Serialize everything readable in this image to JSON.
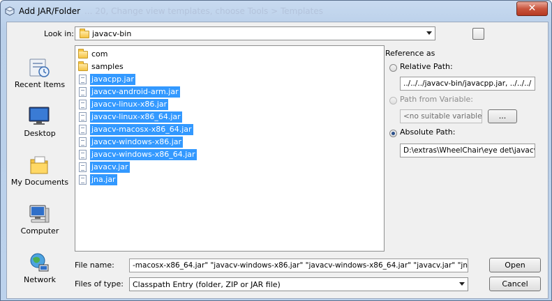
{
  "window": {
    "title": "Add JAR/Folder",
    "title_ghost": "... 20, Change view templates, choose Tools > Templates",
    "close_label": "✕"
  },
  "lookin": {
    "label": "Look in:",
    "value": "javacv-bin"
  },
  "places": [
    {
      "label": "Recent Items",
      "icon": "recent-items-icon"
    },
    {
      "label": "Desktop",
      "icon": "desktop-icon"
    },
    {
      "label": "My Documents",
      "icon": "my-documents-icon"
    },
    {
      "label": "Computer",
      "icon": "computer-icon"
    },
    {
      "label": "Network",
      "icon": "network-icon"
    }
  ],
  "files": [
    {
      "name": "com",
      "type": "folder",
      "selected": false
    },
    {
      "name": "samples",
      "type": "folder",
      "selected": false
    },
    {
      "name": "javacpp.jar",
      "type": "jar",
      "selected": true
    },
    {
      "name": "javacv-android-arm.jar",
      "type": "jar",
      "selected": true
    },
    {
      "name": "javacv-linux-x86.jar",
      "type": "jar",
      "selected": true
    },
    {
      "name": "javacv-linux-x86_64.jar",
      "type": "jar",
      "selected": true
    },
    {
      "name": "javacv-macosx-x86_64.jar",
      "type": "jar",
      "selected": true
    },
    {
      "name": "javacv-windows-x86.jar",
      "type": "jar",
      "selected": true
    },
    {
      "name": "javacv-windows-x86_64.jar",
      "type": "jar",
      "selected": true
    },
    {
      "name": "javacv.jar",
      "type": "jar",
      "selected": true
    },
    {
      "name": "jna.jar",
      "type": "jar",
      "selected": true
    }
  ],
  "reference": {
    "heading": "Reference as",
    "relative_label": "Relative Path:",
    "relative_value": "../../../javacv-bin/javacpp.jar, ../../../",
    "variable_label": "Path from Variable:",
    "variable_value": "<no suitable variable>",
    "variable_button": "...",
    "absolute_label": "Absolute Path:",
    "absolute_value": "D:\\extras\\WheelChair\\eye det\\javacv\\"
  },
  "filename": {
    "label": "File name:",
    "value": "-macosx-x86_64.jar\" \"javacv-windows-x86.jar\" \"javacv-windows-x86_64.jar\" \"javacv.jar\" \"jna.jar\""
  },
  "filetype": {
    "label": "Files of type:",
    "value": "Classpath Entry (folder, ZIP or JAR file)"
  },
  "buttons": {
    "open": "Open",
    "cancel": "Cancel"
  },
  "colors": {
    "selection": "#3399ff",
    "window_frame": "#bcd2ec",
    "close": "#c9553e"
  }
}
